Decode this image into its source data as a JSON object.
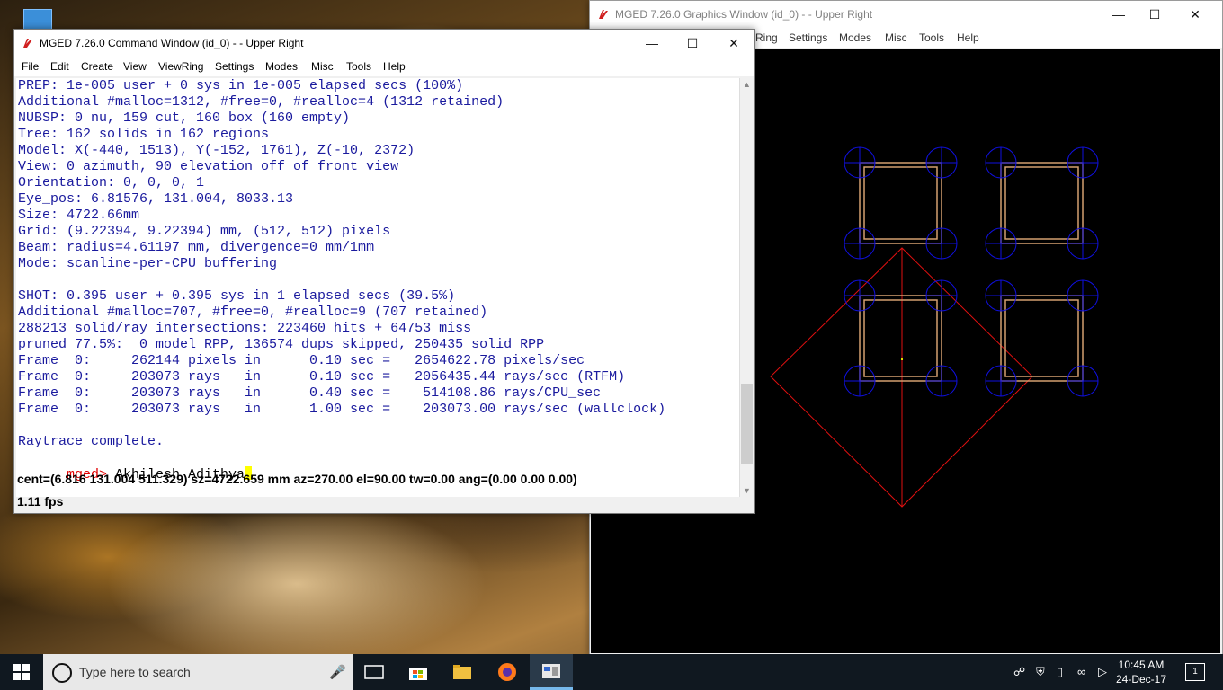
{
  "desktop": {
    "recycle_label": ""
  },
  "graphics_window": {
    "title": "MGED 7.26.0 Graphics Window (id_0) -  - Upper Right",
    "menu": [
      "Ring",
      "Settings",
      "Modes",
      "Misc",
      "Tools",
      "Help"
    ]
  },
  "command_window": {
    "title": "MGED 7.26.0 Command Window (id_0) -  - Upper Right",
    "menu": [
      "File",
      "Edit",
      "Create",
      "View",
      "ViewRing",
      "Settings",
      "Modes",
      "Misc",
      "Tools",
      "Help"
    ],
    "console_lines": [
      "PREP: 1e-005 user + 0 sys in 1e-005 elapsed secs (100%)",
      "Additional #malloc=1312, #free=0, #realloc=4 (1312 retained)",
      "NUBSP: 0 nu, 159 cut, 160 box (160 empty)",
      "Tree: 162 solids in 162 regions",
      "Model: X(-440, 1513), Y(-152, 1761), Z(-10, 2372)",
      "View: 0 azimuth, 90 elevation off of front view",
      "Orientation: 0, 0, 0, 1",
      "Eye_pos: 6.81576, 131.004, 8033.13",
      "Size: 4722.66mm",
      "Grid: (9.22394, 9.22394) mm, (512, 512) pixels",
      "Beam: radius=4.61197 mm, divergence=0 mm/1mm",
      "Mode: scanline-per-CPU buffering",
      "",
      "SHOT: 0.395 user + 0.395 sys in 1 elapsed secs (39.5%)",
      "Additional #malloc=707, #free=0, #realloc=9 (707 retained)",
      "288213 solid/ray intersections: 223460 hits + 64753 miss",
      "pruned 77.5%:  0 model RPP, 136574 dups skipped, 250435 solid RPP",
      "Frame  0:     262144 pixels in      0.10 sec =   2654622.78 pixels/sec",
      "Frame  0:     203073 rays   in      0.10 sec =   2056435.44 rays/sec (RTFM)",
      "Frame  0:     203073 rays   in      0.40 sec =    514108.86 rays/CPU_sec",
      "Frame  0:     203073 rays   in      1.00 sec =    203073.00 rays/sec (wallclock)",
      "",
      "Raytrace complete."
    ],
    "prompt_label": "mged>",
    "prompt_input": " Akhilesh Adithya",
    "status_line": "cent=(6.816 131.004 511.329) sz=4722.659  mm  az=270.00  el=90.00  tw=0.00  ang=(0.00 0.00 0.00)",
    "fps_line": "1.11 fps"
  },
  "taskbar": {
    "search_placeholder": "Type here to search",
    "time": "10:45 AM",
    "date": "24-Dec-17",
    "notification_count": "1"
  },
  "colors": {
    "wireframe_red": "#e01010",
    "wireframe_blue": "#1010e0",
    "wireframe_tan": "#d4a070",
    "console_text": "#1a1a9e",
    "prompt_red": "#e00000"
  }
}
